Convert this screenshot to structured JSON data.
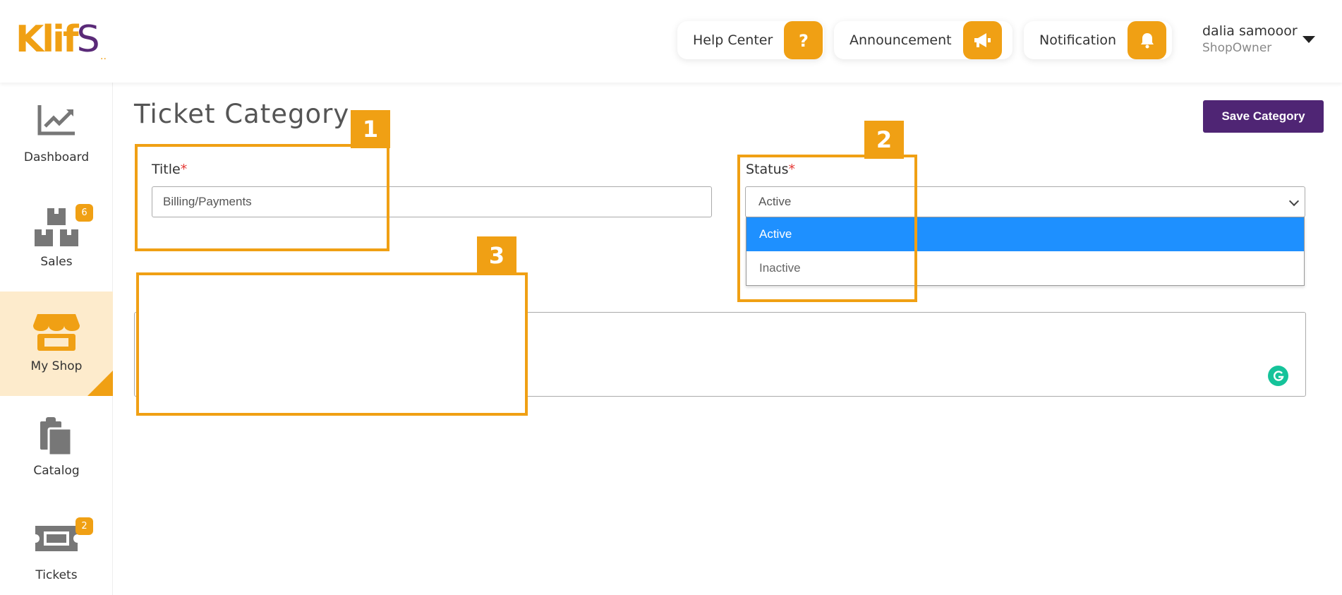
{
  "brand": {
    "logo_main": "Klif",
    "logo_accent": "S",
    "logo_dots": "..",
    "accent_color": "#f0a014",
    "brand_color": "#4f2574"
  },
  "header": {
    "help_center": "Help Center",
    "announcement": "Announcement",
    "notification": "Notification",
    "user_name": "dalia samooor",
    "user_role": "ShopOwner"
  },
  "sidebar": {
    "items": [
      {
        "label": "Dashboard",
        "icon": "chart-icon",
        "badge": ""
      },
      {
        "label": "Sales",
        "icon": "boxes-icon",
        "badge": "6"
      },
      {
        "label": "My Shop",
        "icon": "store-icon",
        "badge": ""
      },
      {
        "label": "Catalog",
        "icon": "clipboard-icon",
        "badge": ""
      },
      {
        "label": "Tickets",
        "icon": "ticket-icon",
        "badge": "2"
      }
    ]
  },
  "main": {
    "page_title": "Ticket Category",
    "save_button": "Save Category",
    "title_label": "Title",
    "title_value": "Billing/Payments",
    "required_mark": "*",
    "status_label": "Status",
    "status_value": "Active",
    "status_options": [
      "Active",
      "Inactive"
    ]
  },
  "annotations": [
    "1",
    "2",
    "3"
  ]
}
